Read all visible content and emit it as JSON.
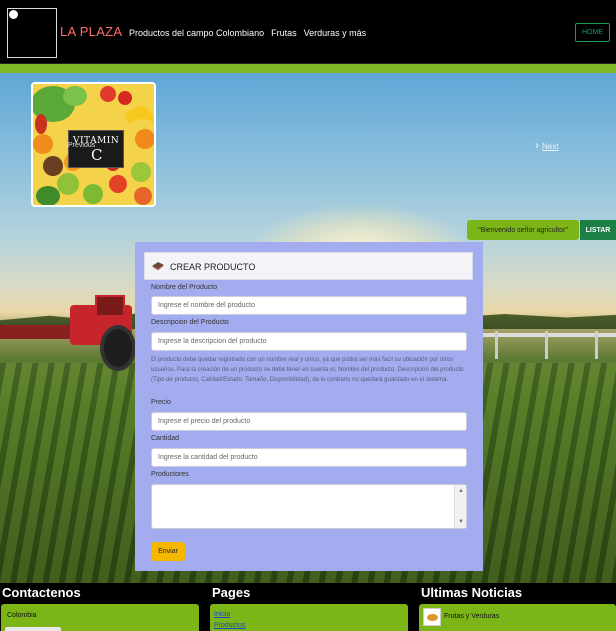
{
  "navbar": {
    "brand": "LA PLAZA",
    "links": [
      "Productos del campo Colombiano",
      "Frutas",
      "Verduras y más"
    ],
    "home_label": "HOME"
  },
  "carousel": {
    "image_text": "VITAMIN",
    "image_text_c": "C",
    "previous_label": "Previous",
    "next_label": "Next"
  },
  "welcome": {
    "message": "\"Bienvenido señor agricultor\"",
    "listar_label": "LISTAR"
  },
  "form": {
    "title": "CREAR PRODUCTO",
    "fields": {
      "nombre": {
        "label": "Nombre del Producto",
        "placeholder": "Ingrese el nombre del producto"
      },
      "descripcion": {
        "label": "Descripcion del Producto",
        "placeholder": "Ingrese la descripcion del producto"
      },
      "precio": {
        "label": "Precio",
        "placeholder": "Ingrese el precio del producto"
      },
      "cantidad": {
        "label": "Cantidad",
        "placeholder": "Ingrese la cantidad del producto"
      },
      "productores": {
        "label": "Productores"
      }
    },
    "help_text": "El producto debe quedar registrado con un nombre real y unico, ya que podrá ser más facil su ubicación por otros usuarios. Para la creación de un producto se debe tener en cuenta el, Nombre del producto, Descripción del producto (Tipo de producto, Calidad/Estado, Tamaño, Disponibilidad), de lo contrario no quedará guardado en el sistema.",
    "submit_label": "Enviar"
  },
  "footer": {
    "contact": {
      "title": "Contactenos",
      "country": "Colombia"
    },
    "pages": {
      "title": "Pages",
      "links": [
        "Inicio",
        "Productos"
      ]
    },
    "news": {
      "title": "Ultimas Noticias",
      "item": "Frutas y Verduras"
    }
  },
  "colors": {
    "navbar_bg": "#000000",
    "brand": "#ff6b6b",
    "accent_green": "#80b828",
    "form_bg": "#a3acef",
    "submit_button": "#f5b700",
    "listar_button": "#1b7f46"
  }
}
